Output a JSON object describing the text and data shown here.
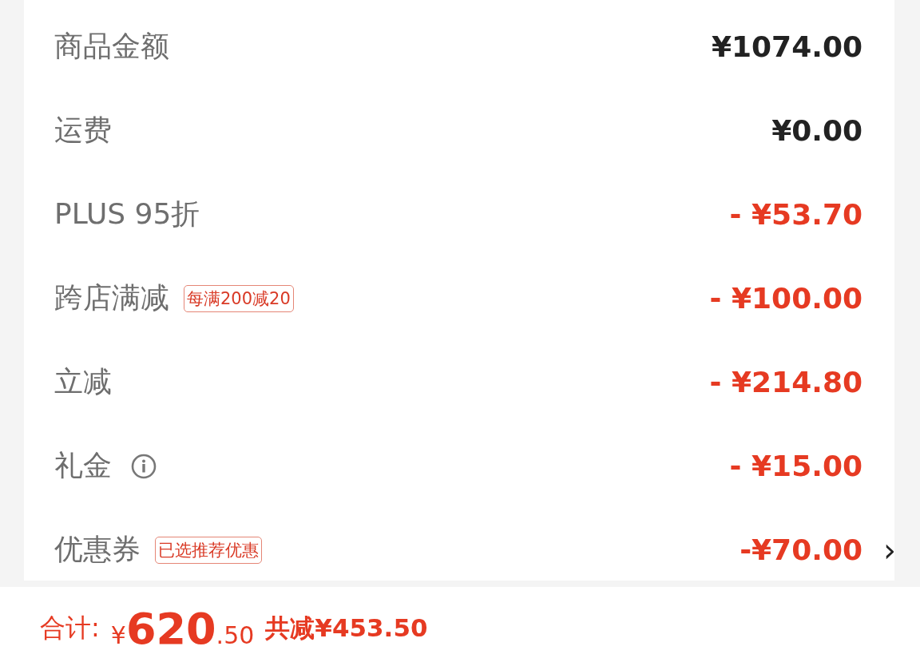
{
  "rows": [
    {
      "label": "商品金额",
      "kind": "plain",
      "amount": "¥1074.00"
    },
    {
      "label": "运费",
      "kind": "plain",
      "amount": "¥0.00"
    },
    {
      "label": "PLUS 95折",
      "kind": "discount",
      "amount": "- ¥53.70"
    },
    {
      "label": "跨店满减",
      "tag": "每满200减20",
      "kind": "discount",
      "amount": "- ¥100.00"
    },
    {
      "label": "立减",
      "kind": "discount",
      "amount": "- ¥214.80"
    },
    {
      "label": "礼金",
      "info": true,
      "kind": "discount",
      "amount": "- ¥15.00"
    },
    {
      "label": "优惠券",
      "tag": "已选推荐优惠",
      "kind": "discount",
      "amount": "-¥70.00",
      "chevron": "›"
    }
  ],
  "footer": {
    "total_label": "合计:",
    "total_currency": "¥",
    "total_integer": "620",
    "total_decimal": ".50",
    "savings": "共减¥453.50"
  }
}
